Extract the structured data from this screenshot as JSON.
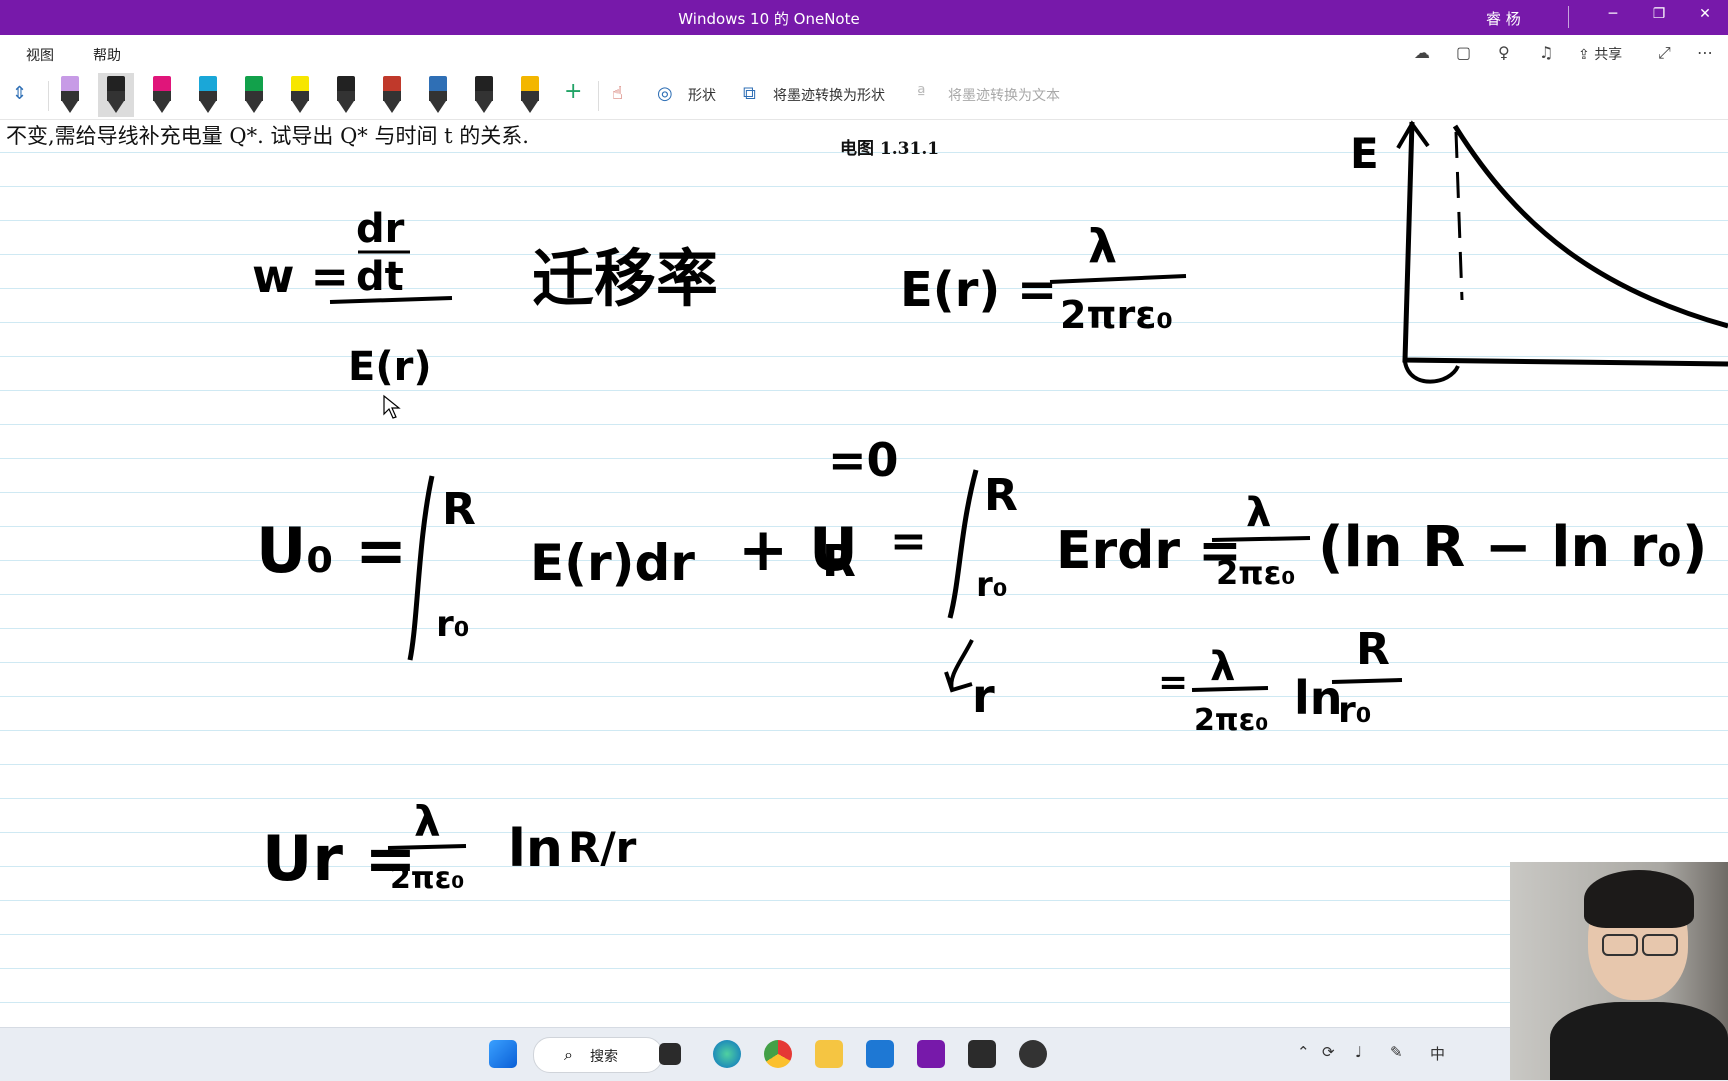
{
  "window": {
    "title": "Windows 10 的 OneNote",
    "user": "睿 杨",
    "minimize": "─",
    "restore": "❐",
    "close": "✕"
  },
  "menu": {
    "view": "视图",
    "help": "帮助",
    "share": "共享",
    "more": "⋯"
  },
  "toolbar": {
    "shapes": "形状",
    "ink_to_shape": "将墨迹转换为形状",
    "ink_to_text": "将墨迹转换为文本",
    "add_pen": "+"
  },
  "pens": [
    "#c79be6",
    "#222222",
    "#e0157a",
    "#1aa7d8",
    "#12a14b",
    "#f7e600",
    "#222222",
    "#c0392b",
    "#2f6fb5",
    "#222222",
    "#f3b600"
  ],
  "page": {
    "problem": "不变,需给导线补充电量 Q*. 试导出 Q* 与时间 t 的关系.",
    "caption": "电图 1.31.1"
  },
  "ink": {
    "w_lhs": "w =",
    "dr": "dr",
    "dt": "dt",
    "er_den": "E(r)",
    "chinese": "迁移率",
    "e_lhs": "E(r) =",
    "lambda": "λ",
    "e_den": "2πrε₀",
    "graph_label": "E",
    "u0": "U₀ =",
    "int_upper": "R",
    "int_lower": "r₀",
    "integrand": "E(r)dr",
    "plus_ur": "+ U",
    "ur_sub": "R",
    "ur_zero": "=0",
    "equals": "=",
    "int2_upper": "R",
    "int2_lower": "r₀",
    "integrand2": "Erdr =",
    "lambda2": "λ",
    "den2": "2πε₀",
    "bracket": "(ln R − ln r₀)",
    "arrow_r": "r",
    "eq3": "=",
    "lambda3": "λ",
    "den3": "2πε₀",
    "ln3": "ln",
    "frac_num": "R",
    "frac_den": "r₀",
    "ur_lhs": "Ur =",
    "lambda4": "λ",
    "den4": "2πε₀",
    "ln4": "ln",
    "frac4": "R/r"
  },
  "taskbar": {
    "search": "搜索",
    "ime": "中"
  }
}
